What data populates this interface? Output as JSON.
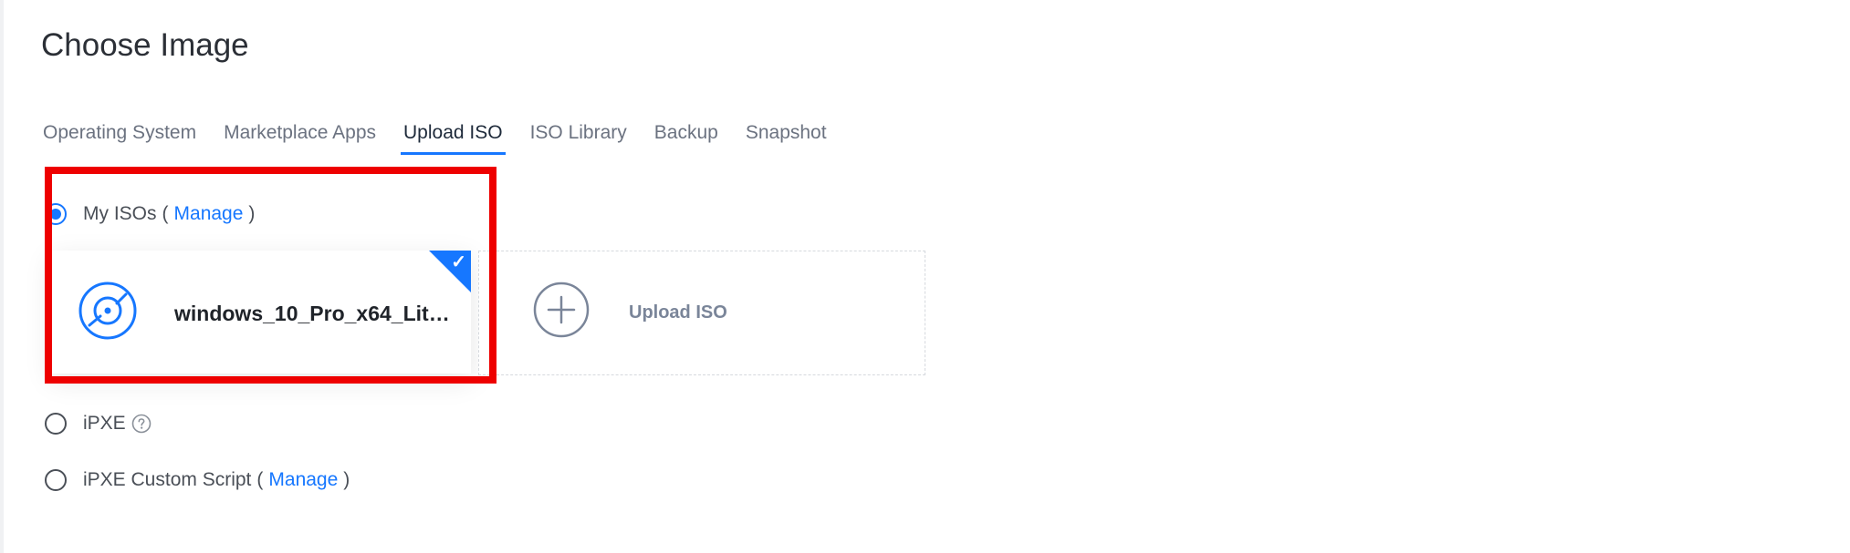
{
  "page": {
    "title": "Choose Image"
  },
  "tabs": [
    {
      "label": "Operating System",
      "active": false
    },
    {
      "label": "Marketplace Apps",
      "active": false
    },
    {
      "label": "Upload ISO",
      "active": true
    },
    {
      "label": "ISO Library",
      "active": false
    },
    {
      "label": "Backup",
      "active": false
    },
    {
      "label": "Snapshot",
      "active": false
    }
  ],
  "my_isos": {
    "label": "My ISOs",
    "open_paren": "(",
    "manage_link": "Manage",
    "close_paren": ")",
    "selected": true
  },
  "iso_card": {
    "name": "windows_10_Pro_x64_Lite_...",
    "icon": "disc-icon",
    "selected_icon": "checkmark-icon"
  },
  "upload": {
    "label": "Upload ISO",
    "icon": "plus-circle-icon"
  },
  "ipxe": {
    "label": "iPXE",
    "help_icon": "question-circle-icon",
    "selected": false
  },
  "ipxe_custom": {
    "label": "iPXE Custom Script",
    "open_paren": "(",
    "manage_link": "Manage",
    "close_paren": ")",
    "selected": false
  },
  "colors": {
    "accent": "#1677ff",
    "highlight": "#ee0000",
    "text": "#4a4f57",
    "muted": "#7a8599"
  }
}
